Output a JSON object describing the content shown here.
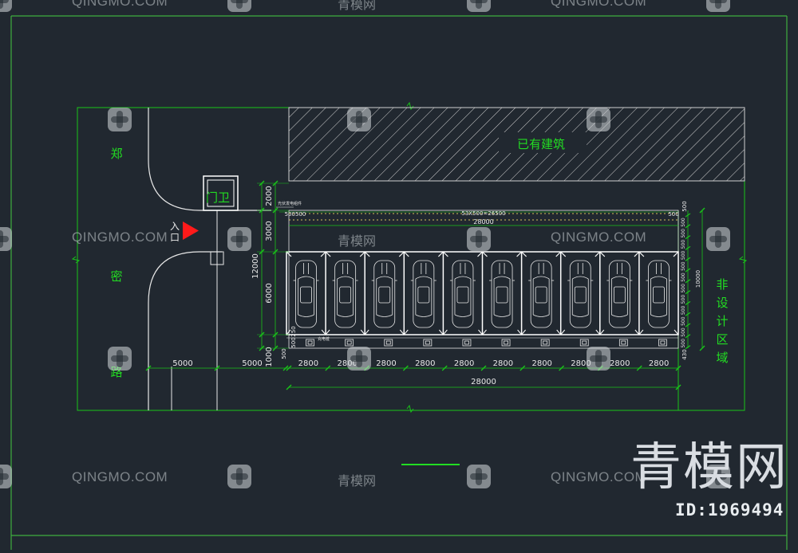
{
  "labels": {
    "existing_building": "已有建筑",
    "guard_house": "门卫",
    "entrance_1": "入",
    "entrance_2": "口",
    "road": [
      "郑",
      "密",
      "路"
    ],
    "non_design_area": [
      "非",
      "设",
      "计",
      "区",
      "域"
    ]
  },
  "dimensions": {
    "left_vertical": [
      "2000",
      "3000",
      "12000",
      "6000",
      "1000"
    ],
    "road_widths": [
      "5000",
      "5000"
    ],
    "bay_widths": [
      "2800",
      "2800",
      "2800",
      "2800",
      "2800",
      "2800",
      "2800",
      "2800",
      "2800",
      "2800"
    ],
    "total_width_top": "28000",
    "total_width_bottom": "28000",
    "top_chain": "53X500=26500",
    "top_start": "500500",
    "top_end": "500",
    "right_total": "10000",
    "right_small": [
      "500",
      "500",
      "500",
      "500",
      "500",
      "500",
      "500",
      "500",
      "500",
      "500",
      "500",
      "500"
    ],
    "right_bottom": "430",
    "left_small": [
      "250",
      "500",
      "500"
    ]
  },
  "small_notes": {
    "top_left": "光伏发电组件",
    "bottom_left": "充电桩"
  },
  "watermarks": {
    "latin": "QINGMO.COM",
    "chinese": "青模网",
    "big_brand": "青模网",
    "image_id": "ID:1969494"
  },
  "colors": {
    "background": "#212830",
    "line_green": "#19c419",
    "label_green": "#22dd22",
    "white": "#e8e8e8",
    "hatch": "#cfcfcf",
    "entrance_arrow": "#ff1a1a",
    "dim_yellow": "#d6c25a"
  },
  "parking": {
    "space_count": 10
  }
}
